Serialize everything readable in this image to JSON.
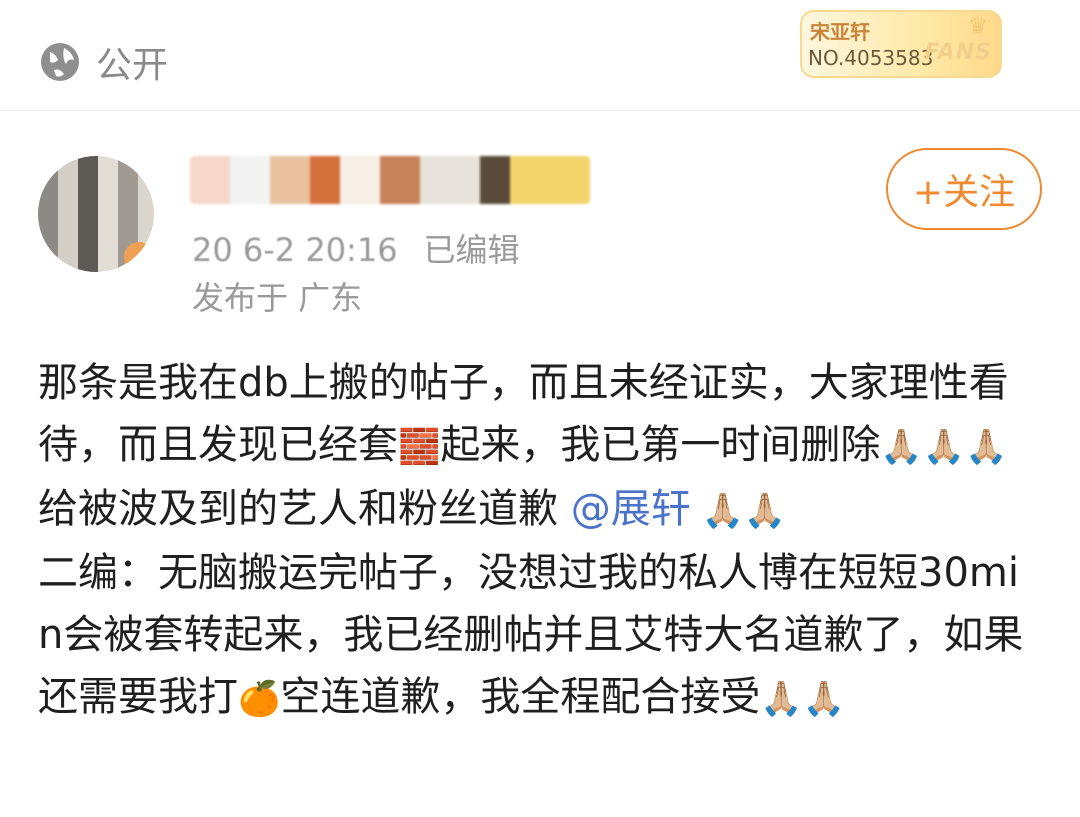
{
  "header": {
    "visibility_label": "公开",
    "fans_badge": {
      "name": "宋亚轩",
      "number": "NO.4053583",
      "word": "FANS"
    }
  },
  "author": {
    "time_text": "20 6-2 20:16",
    "edited_label": "已编辑",
    "location_text": "发布于 广东",
    "follow_label": "+关注"
  },
  "post": {
    "segment_1": "那条是我在db上搬的帖子，而且未经证实，大家理性看待，而且发现已经套",
    "emoji_wall": "🧱",
    "segment_2": "起来，我已第一时间删除",
    "emoji_pray_a": "🙏🏼🙏🏼🙏🏼",
    "segment_3": "给被波及到的艺人和粉丝道歉 ",
    "mention": "@展轩",
    "emoji_pray_b": " 🙏🏼🙏🏼",
    "segment_4": "\n二编：无脑搬运完帖子，没想过我的私人博在短短30min会被套转起来，我已经删帖并且艾特大名道歉了，如果还需要我打",
    "emoji_orange": "🍊",
    "segment_5": "空连道歉，我全程配合接受",
    "emoji_pray_c": "🙏🏼🙏🏼"
  },
  "colors": {
    "accent": "#f08a30",
    "mention": "#4a73c9",
    "meta": "#9a9a9a"
  }
}
